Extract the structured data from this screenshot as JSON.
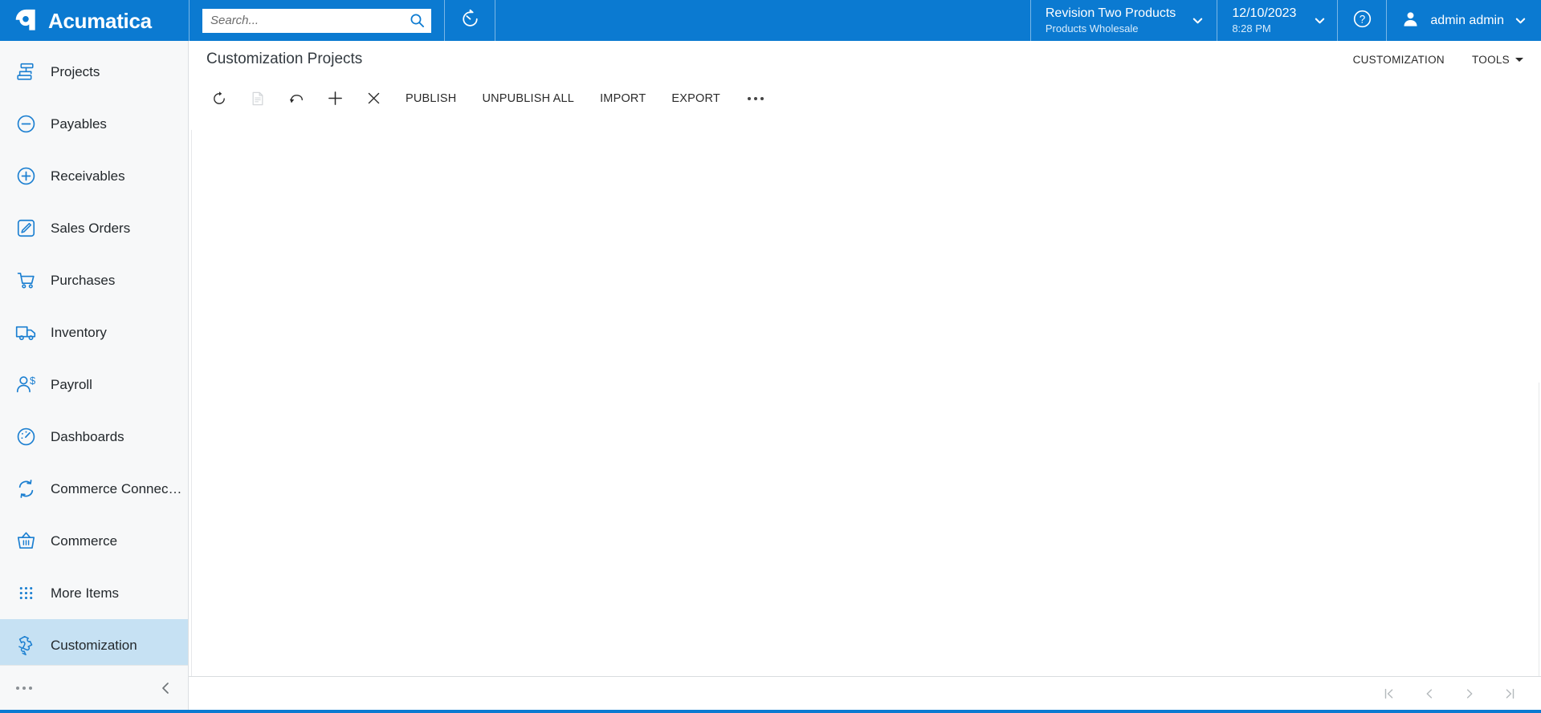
{
  "header": {
    "brand_name": "Acumatica",
    "brand_logo_icon": "acumatica-droplet-logo",
    "search": {
      "placeholder": "Search...",
      "value": "",
      "icon": "search-icon"
    },
    "timer_icon": "stopwatch-timer-icon",
    "organization": {
      "primary": "Revision Two Products",
      "secondary": "Products Wholesale",
      "chevron_icon": "chevron-down-icon"
    },
    "datetime": {
      "date": "12/10/2023",
      "time": "8:28 PM",
      "chevron_icon": "chevron-down-icon"
    },
    "help_icon": "help-question-circle-icon",
    "user": {
      "name": "admin admin",
      "avatar_icon": "user-avatar-icon",
      "chevron_icon": "chevron-down-icon"
    },
    "background_color": "#0b7ad1"
  },
  "sidebar": {
    "background_color": "#f7f8f9",
    "active_background_color": "#c6e1f3",
    "icon_color": "#1b7fd1",
    "items": [
      {
        "label": "Projects",
        "icon": "projects-gantt-icon",
        "active": false
      },
      {
        "label": "Payables",
        "icon": "minus-circle-icon",
        "active": false
      },
      {
        "label": "Receivables",
        "icon": "plus-circle-icon",
        "active": false
      },
      {
        "label": "Sales Orders",
        "icon": "pencil-square-icon",
        "active": false
      },
      {
        "label": "Purchases",
        "icon": "shopping-cart-icon",
        "active": false
      },
      {
        "label": "Inventory",
        "icon": "delivery-truck-icon",
        "active": false
      },
      {
        "label": "Payroll",
        "icon": "person-dollar-icon",
        "active": false
      },
      {
        "label": "Dashboards",
        "icon": "gauge-dashboard-icon",
        "active": false
      },
      {
        "label": "Commerce Connec…",
        "icon": "sync-arrows-icon",
        "active": false
      },
      {
        "label": "Commerce",
        "icon": "shopping-basket-icon",
        "active": false
      },
      {
        "label": "More Items",
        "icon": "grid-dots-icon",
        "active": false
      },
      {
        "label": "Customization",
        "icon": "puzzle-piece-icon",
        "active": true
      }
    ],
    "footer": {
      "more_icon": "ellipsis-icon",
      "collapse_icon": "chevron-left-icon"
    }
  },
  "page": {
    "title": "Customization Projects",
    "header_links": [
      {
        "label": "CUSTOMIZATION",
        "has_caret": false
      },
      {
        "label": "TOOLS",
        "has_caret": true
      }
    ]
  },
  "toolbar": {
    "icons": [
      {
        "name": "refresh-icon",
        "disabled": false
      },
      {
        "name": "save-icon",
        "disabled": true
      },
      {
        "name": "undo-icon",
        "disabled": false
      },
      {
        "name": "add-icon",
        "disabled": false
      },
      {
        "name": "delete-icon",
        "disabled": false
      }
    ],
    "buttons": [
      {
        "label": "PUBLISH"
      },
      {
        "label": "UNPUBLISH ALL"
      },
      {
        "label": "IMPORT"
      },
      {
        "label": "EXPORT"
      }
    ],
    "overflow_icon": "ellipsis-icon"
  },
  "grid": {
    "rows": [],
    "empty": true
  },
  "pagination": {
    "buttons": [
      {
        "name": "first-page-button",
        "icon": "first-page-icon"
      },
      {
        "name": "previous-page-button",
        "icon": "previous-page-icon"
      },
      {
        "name": "next-page-button",
        "icon": "next-page-icon"
      },
      {
        "name": "last-page-button",
        "icon": "last-page-icon"
      }
    ]
  }
}
